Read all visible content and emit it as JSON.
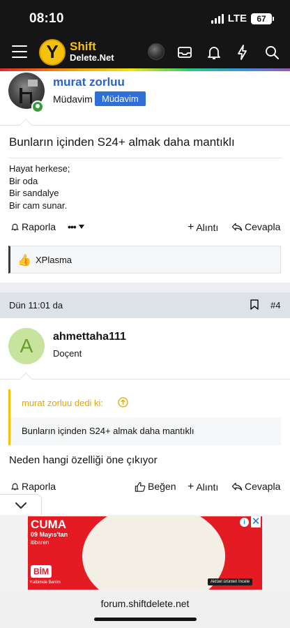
{
  "status_bar": {
    "time": "08:10",
    "network": "LTE",
    "battery": "67"
  },
  "nav": {
    "logo_shift": "Shift",
    "logo_delete": "Delete",
    "logo_net": ".Net",
    "icons": [
      "menu-icon",
      "avatar",
      "inbox-icon",
      "bell-icon",
      "lightning-icon",
      "search-icon"
    ]
  },
  "post1": {
    "username": "murat zorluu",
    "user_title": "Müdavim",
    "banner": "Müdavim",
    "title": "Bunların içinden S24+ almak daha mantıklı",
    "lines": [
      "Hayat herkese;",
      "Bir oda",
      "Bir sandalye",
      "Bir cam sunar."
    ],
    "actions": {
      "report": "Raporla",
      "more": "•••",
      "reply": "Alıntı",
      "respond": "Cevapla"
    },
    "reaction_user": "XPlasma"
  },
  "post2": {
    "date": "Dün 11:01 da",
    "number": "#4",
    "avatar_letter": "A",
    "username": "ahmettaha111",
    "user_title": "Doçent",
    "quote_author": "murat zorluu dedi ki:",
    "quote_text": "Bunların içinden S24+ almak daha mantıklı",
    "message": "Neden hangi özelliği öne çıkıyor",
    "actions": {
      "report": "Raporla",
      "like": "Beğen",
      "reply": "Alıntı",
      "respond": "Cevapla"
    }
  },
  "ad": {
    "headline": "CUMA",
    "date": "09 Mayıs'tan",
    "since": "itibaren",
    "brand": "BİM",
    "brand_sub": "Kalbimde Benim",
    "button": "Aktüel ürünleri İncele"
  },
  "browser": {
    "url": "forum.shiftdelete.net"
  }
}
